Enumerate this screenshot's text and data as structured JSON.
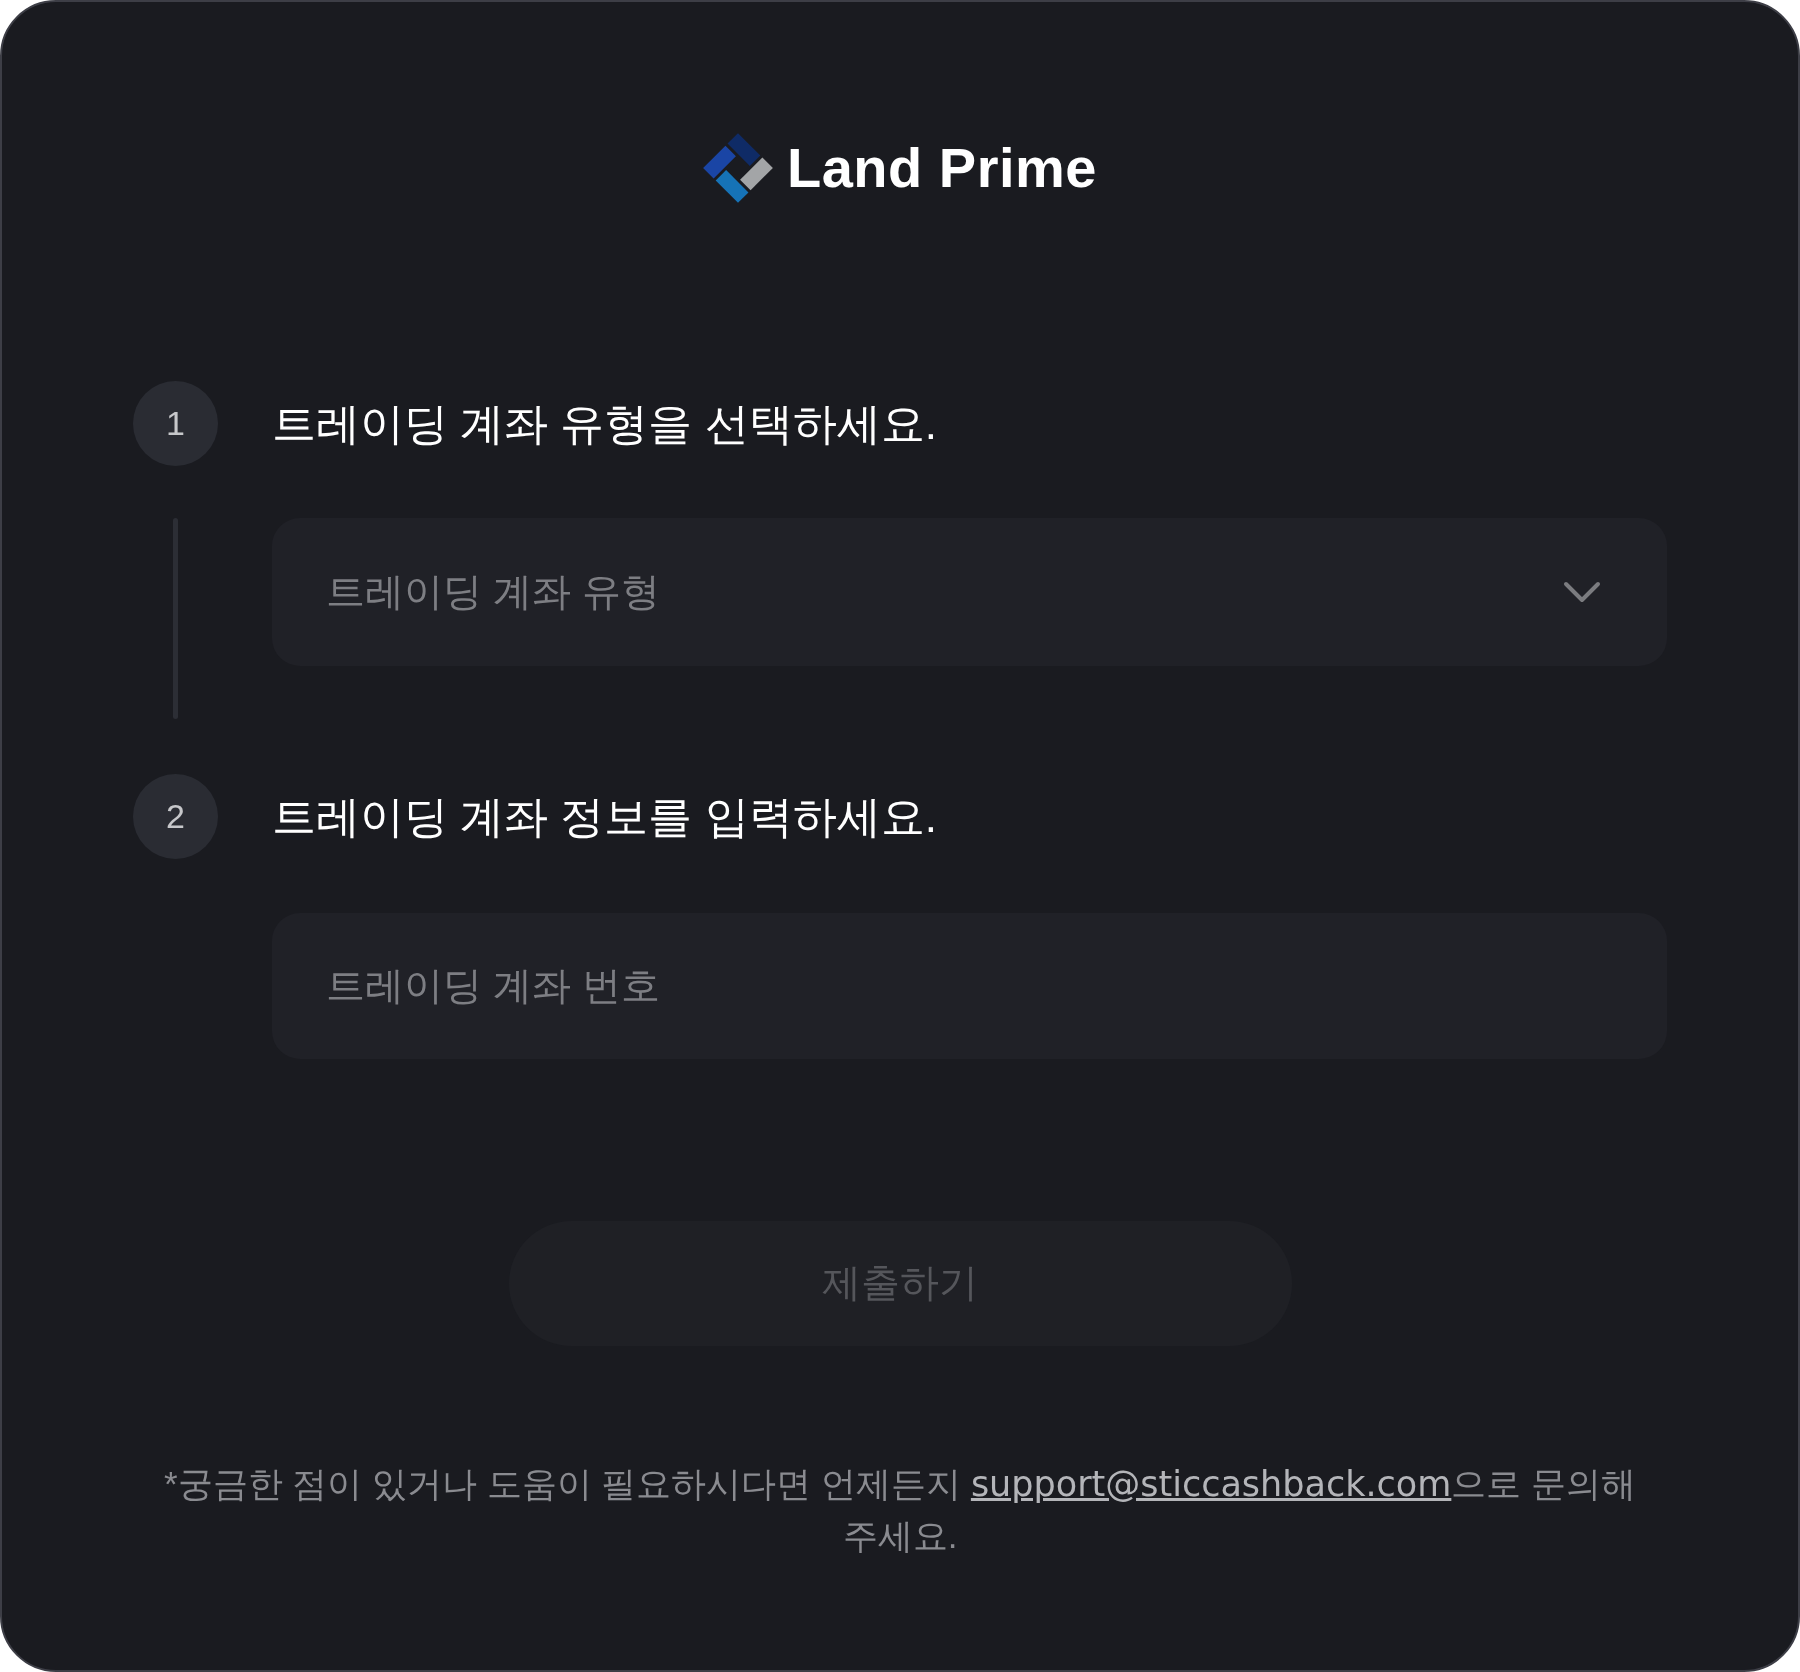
{
  "logo": {
    "name": "Land Prime"
  },
  "steps": [
    {
      "number": "1",
      "title": "트레이딩 계좌 유형을 선택하세요.",
      "field": {
        "kind": "select",
        "placeholder": "트레이딩 계좌 유형"
      }
    },
    {
      "number": "2",
      "title": "트레이딩 계좌 정보를 입력하세요.",
      "field": {
        "kind": "input",
        "placeholder": "트레이딩 계좌 번호"
      }
    }
  ],
  "submit_button": {
    "label": "제출하기",
    "disabled": true
  },
  "help_note": {
    "text_before": "*궁금한 점이 있거나 도움이 필요하시다면 언제든지 ",
    "link": "support@sticcashback.com",
    "text_after": "으로 문의해 주세요."
  }
}
